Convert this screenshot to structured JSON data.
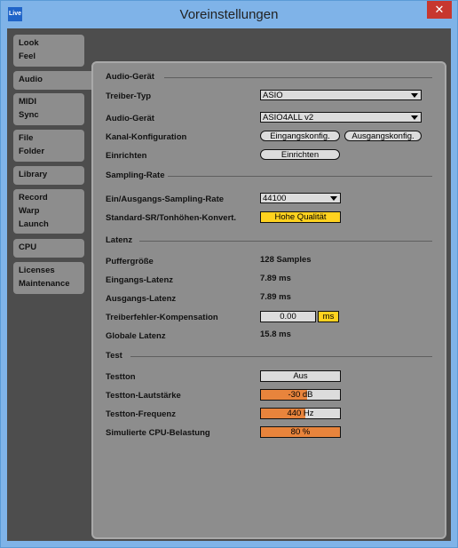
{
  "window": {
    "app_icon_text": "Live",
    "title": "Voreinstellungen",
    "close_glyph": "✕"
  },
  "sidebar": {
    "groups": [
      {
        "lines": [
          "Look",
          "Feel"
        ]
      },
      {
        "lines": [
          "Audio"
        ]
      },
      {
        "lines": [
          "MIDI",
          "Sync"
        ]
      },
      {
        "lines": [
          "File",
          "Folder"
        ]
      },
      {
        "lines": [
          "Library"
        ]
      },
      {
        "lines": [
          "Record",
          "Warp",
          "Launch"
        ]
      },
      {
        "lines": [
          "CPU"
        ]
      },
      {
        "lines": [
          "Licenses",
          "Maintenance"
        ]
      }
    ],
    "active": "Audio"
  },
  "audio_device": {
    "section_title": "Audio-Gerät",
    "driver_label": "Treiber-Typ",
    "driver_value": "ASIO",
    "device_label": "Audio-Gerät",
    "device_value": "ASIO4ALL v2",
    "channel_label": "Kanal-Konfiguration",
    "input_config": "Eingangskonfig.",
    "output_config": "Ausgangskonfig.",
    "setup_label": "Einrichten",
    "setup_button": "Einrichten"
  },
  "sampling": {
    "section_title": "Sampling-Rate",
    "rate_label": "Ein/Ausgangs-Sampling-Rate",
    "rate_value": "44100",
    "sr_label": "Standard-SR/Tonhöhen-Konvert.",
    "sr_value": "Hohe Qualität"
  },
  "latency": {
    "section_title": "Latenz",
    "buffer_label": "Puffergröße",
    "buffer_value": "128 Samples",
    "input_label": "Eingangs-Latenz",
    "input_value": "7.89 ms",
    "output_label": "Ausgangs-Latenz",
    "output_value": "7.89 ms",
    "comp_label": "Treiberfehler-Kompensation",
    "comp_value": "0.00",
    "comp_unit": "ms",
    "overall_label": "Globale Latenz",
    "overall_value": "15.8 ms"
  },
  "test": {
    "section_title": "Test",
    "tone_label": "Testton",
    "tone_value": "Aus",
    "volume_label": "Testton-Lautstärke",
    "volume_value": "-30 dB",
    "volume_fill": 0.58,
    "freq_label": "Testton-Frequenz",
    "freq_value": "440 Hz",
    "freq_fill": 0.56,
    "cpu_label": "Simulierte CPU-Belastung",
    "cpu_value": "80 %",
    "cpu_fill": 1.0
  },
  "colors": {
    "accent_orange": "#e8843c",
    "accent_yellow": "#ffd21f",
    "titlebar": "#7fb3e8"
  }
}
